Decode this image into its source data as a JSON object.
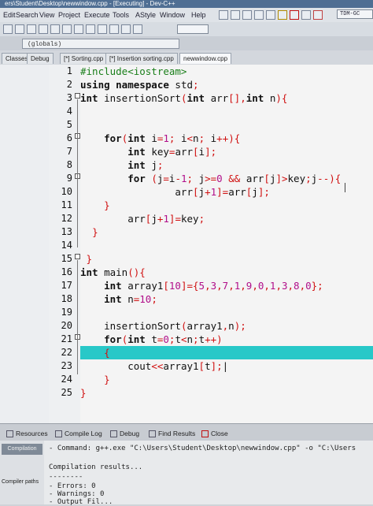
{
  "window": {
    "title": "ers\\Student\\Desktop\\newwindow.cpp - [Executing] - Dev-C++"
  },
  "menu": [
    "Edit",
    "Search",
    "View",
    "Project",
    "Execute",
    "Tools",
    "AStyle",
    "Window",
    "Help"
  ],
  "toolbar": {
    "compiler_profile": "TDM-GC"
  },
  "scope": {
    "value": "(globals)"
  },
  "left_panel": {
    "tabs": [
      "Classes",
      "Debug"
    ]
  },
  "editor_tabs": [
    "[*] Sorting.cpp",
    "[*] Insertion sorting.cpp",
    "newwindow.cpp"
  ],
  "code": {
    "line_numbers": [
      "1",
      "2",
      "3",
      "4",
      "5",
      "6",
      "7",
      "8",
      "9",
      "10",
      "11",
      "12",
      "13",
      "14",
      "15",
      "16",
      "17",
      "18",
      "19",
      "20",
      "21",
      "22",
      "23",
      "24",
      "25"
    ],
    "highlighted_line": 23
  },
  "bottom_panel": {
    "tabs": [
      "Resources",
      "Compile Log",
      "Debug",
      "Find Results",
      "Close"
    ],
    "side_buttons": [
      "Compilation",
      "Compiler paths"
    ],
    "log_lines": [
      "- Command: g++.exe \"C:\\Users\\Student\\Desktop\\newwindow.cpp\" -o \"C:\\Users",
      "",
      "Compilation results...",
      "--------",
      "- Errors: 0",
      "- Warnings: 0",
      "- Output Fil..."
    ]
  }
}
